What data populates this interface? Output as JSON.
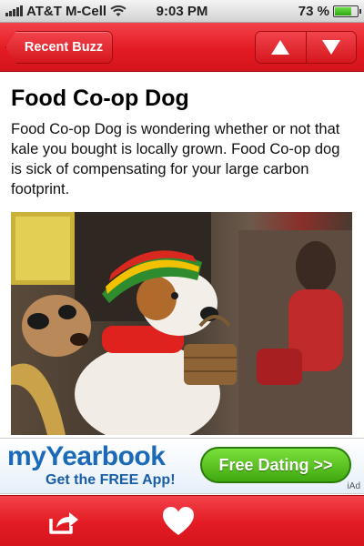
{
  "status_bar": {
    "carrier": "AT&T M-Cell",
    "time": "9:03 PM",
    "battery_text": "73 %",
    "battery_level": 0.73
  },
  "nav": {
    "back_label": "Recent Buzz",
    "up_icon": "up-arrow-icon",
    "down_icon": "down-arrow-icon"
  },
  "article": {
    "title": "Food Co-op Dog",
    "body": "Food Co-op Dog is wondering whether or not that kale you bought is locally grown. Food Co-op dog is sick of compensating for your large carbon footprint."
  },
  "photo": {
    "description_icon": "photo-dogs"
  },
  "ad": {
    "brand": "myYearbook",
    "subtitle": "Get the FREE App!",
    "cta": "Free Dating >>",
    "network": "iAd"
  },
  "bottom_bar": {
    "share_icon": "share-icon",
    "like_icon": "heart-icon"
  },
  "colors": {
    "accent_red": "#e31b23",
    "ad_blue": "#1a6ab8",
    "ad_green": "#3fa90f"
  }
}
